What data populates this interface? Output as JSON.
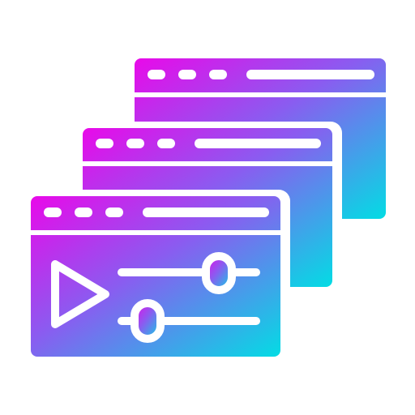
{
  "icon": {
    "name": "stacked-media-player-windows-icon",
    "colors": {
      "gradient_start": "#E909E9",
      "gradient_mid": "#8A5CF0",
      "gradient_end": "#03DCE4",
      "cutout": "#FFFFFF"
    },
    "windows": [
      {
        "name": "back-window"
      },
      {
        "name": "middle-window"
      },
      {
        "name": "front-window"
      }
    ],
    "front_window_content": {
      "play_icon": "play-icon",
      "sliders": [
        {
          "name": "top-slider",
          "level": 0.78
        },
        {
          "name": "bottom-slider",
          "level": 0.22
        }
      ]
    }
  }
}
